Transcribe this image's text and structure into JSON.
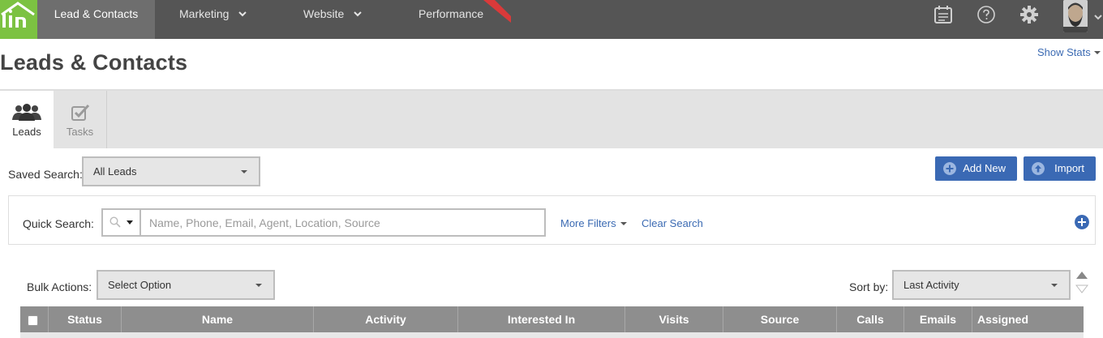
{
  "nav": {
    "logo_text": "Lin",
    "items": [
      {
        "label": "Lead & Contacts"
      },
      {
        "label": "Marketing"
      },
      {
        "label": "Website"
      },
      {
        "label": "Performance"
      }
    ],
    "icons": [
      "calendar-icon",
      "help-icon",
      "gear-icon",
      "avatar",
      "chevron-down-icon"
    ]
  },
  "header": {
    "title": "Leads & Contacts",
    "show_stats": "Show Stats"
  },
  "tabs": [
    {
      "label": "Leads",
      "icon": "users-icon",
      "active": true
    },
    {
      "label": "Tasks",
      "icon": "task-check-icon",
      "active": false
    }
  ],
  "saved_search": {
    "label": "Saved Search:",
    "value": "All Leads"
  },
  "actions": {
    "add_new": "Add New",
    "import": "Import"
  },
  "quick_search": {
    "label": "Quick Search:",
    "placeholder": "Name, Phone, Email, Agent, Location, Source",
    "more_filters": "More Filters",
    "clear_search": "Clear Search"
  },
  "bulk_actions": {
    "label": "Bulk Actions:",
    "value": "Select Option"
  },
  "sort": {
    "label": "Sort by:",
    "value": "Last Activity"
  },
  "table": {
    "columns": [
      "Status",
      "Name",
      "Activity",
      "Interested In",
      "Visits",
      "Source",
      "Calls",
      "Emails",
      "Assigned"
    ]
  },
  "colors": {
    "nav_bg": "#555555",
    "logo_green": "#7cc242",
    "accent_blue": "#3a69b4",
    "table_header": "#8e8e8e",
    "ribbon_red": "#d93a3a"
  }
}
